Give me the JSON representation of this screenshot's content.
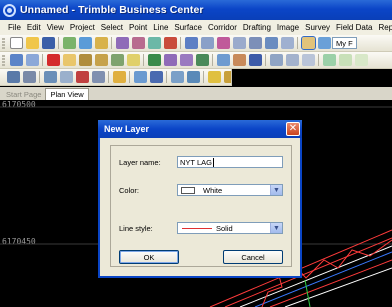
{
  "window": {
    "title": "Unnamed - Trimble Business Center"
  },
  "menu": [
    "File",
    "Edit",
    "View",
    "Project",
    "Select",
    "Point",
    "Line",
    "Surface",
    "Corridor",
    "Drafting",
    "Image",
    "Survey",
    "Field Data",
    "Reports"
  ],
  "toolbar": {
    "layer_box_text": "My F"
  },
  "tabs": [
    "Start Page",
    "Plan View"
  ],
  "plan": {
    "coord_top": "6170500",
    "coord_mid": "6170450"
  },
  "dialog": {
    "title": "New Layer",
    "close_glyph": "✕",
    "layer_name_label": "Layer name:",
    "layer_name_value": "NYT LAG",
    "color_label": "Color:",
    "color_value": "White",
    "line_style_label": "Line style:",
    "line_style_value": "Solid",
    "ok_label": "OK",
    "cancel_label": "Cancel"
  },
  "colors": {
    "titlebar": "#0b45c7",
    "dialog_bg": "#ece9d8",
    "plan_bg": "#000000",
    "line_sample": "#e03030"
  }
}
